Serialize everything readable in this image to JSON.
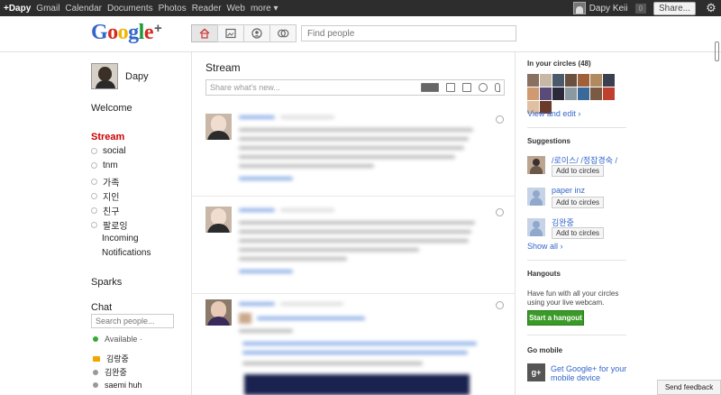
{
  "topbar": {
    "nav": [
      "+Dapy",
      "Gmail",
      "Calendar",
      "Documents",
      "Photos",
      "Reader",
      "Web",
      "more ▾"
    ],
    "user_name": "Dapy Keii",
    "notif_count": "0",
    "share_label": "Share...",
    "gear_icon": "⚙"
  },
  "header": {
    "logo": {
      "g1": "G",
      "o1": "o",
      "o2": "o",
      "g2": "g",
      "l": "l",
      "e": "e",
      "plus": "+"
    },
    "search_placeholder": "Find people"
  },
  "left": {
    "profile_name": "Dapy",
    "welcome": "Welcome",
    "stream": "Stream",
    "circles": [
      "social",
      "tnm",
      "가족",
      "지인",
      "친구",
      "팔로잉"
    ],
    "incoming": "Incoming",
    "notifications": "Notifications",
    "sparks": "Sparks",
    "chat": "Chat",
    "chat_search_placeholder": "Search people...",
    "available": "Available ·",
    "chat_users": [
      {
        "name": "김랑중",
        "status": "video"
      },
      {
        "name": "김완중",
        "status": "idle"
      },
      {
        "name": "saemi huh",
        "status": "idle"
      }
    ]
  },
  "main": {
    "title": "Stream",
    "share_placeholder": "Share what's new..."
  },
  "right": {
    "circles_head": "In your circles (48)",
    "view_edit": "View and edit ›",
    "suggestions_head": "Suggestions",
    "suggestions": [
      {
        "name": "/로이스/ /정잡경숙 /",
        "button": "Add to circles"
      },
      {
        "name": "paper inz",
        "button": "Add to circles"
      },
      {
        "name": "김완중",
        "button": "Add to circles"
      }
    ],
    "show_all": "Show all ›",
    "hangouts_head": "Hangouts",
    "hangouts_text": "Have fun with all your circles using your live webcam.",
    "hangout_button": "Start a hangout",
    "mobile_head": "Go mobile",
    "gplus_icon": "g+",
    "mobile_link": "Get Google+ for your mobile device"
  },
  "feedback": "Send feedback",
  "colors": {
    "accent_red": "#cc0000",
    "link_blue": "#3366cc",
    "hangout_green": "#3a9a28",
    "topbar": "#2d2d2d"
  }
}
